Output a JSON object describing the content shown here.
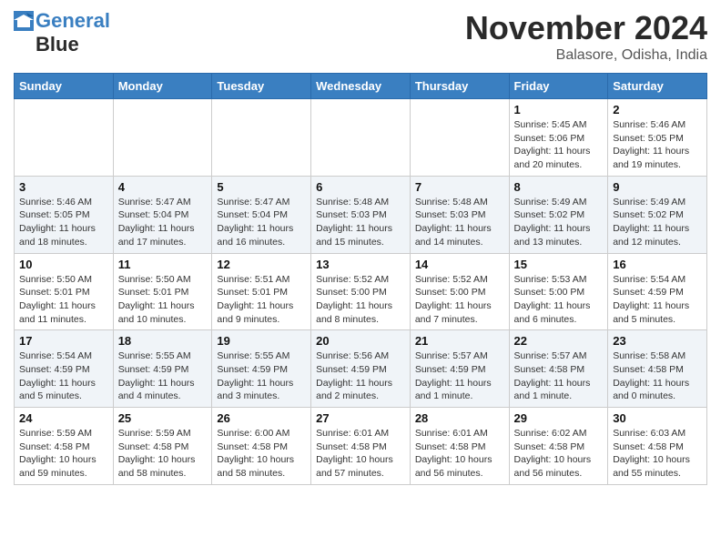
{
  "header": {
    "logo_line1": "General",
    "logo_line2": "Blue",
    "month_title": "November 2024",
    "location": "Balasore, Odisha, India"
  },
  "weekdays": [
    "Sunday",
    "Monday",
    "Tuesday",
    "Wednesday",
    "Thursday",
    "Friday",
    "Saturday"
  ],
  "weeks": [
    [
      {
        "day": "",
        "info": ""
      },
      {
        "day": "",
        "info": ""
      },
      {
        "day": "",
        "info": ""
      },
      {
        "day": "",
        "info": ""
      },
      {
        "day": "",
        "info": ""
      },
      {
        "day": "1",
        "info": "Sunrise: 5:45 AM\nSunset: 5:06 PM\nDaylight: 11 hours\nand 20 minutes."
      },
      {
        "day": "2",
        "info": "Sunrise: 5:46 AM\nSunset: 5:05 PM\nDaylight: 11 hours\nand 19 minutes."
      }
    ],
    [
      {
        "day": "3",
        "info": "Sunrise: 5:46 AM\nSunset: 5:05 PM\nDaylight: 11 hours\nand 18 minutes."
      },
      {
        "day": "4",
        "info": "Sunrise: 5:47 AM\nSunset: 5:04 PM\nDaylight: 11 hours\nand 17 minutes."
      },
      {
        "day": "5",
        "info": "Sunrise: 5:47 AM\nSunset: 5:04 PM\nDaylight: 11 hours\nand 16 minutes."
      },
      {
        "day": "6",
        "info": "Sunrise: 5:48 AM\nSunset: 5:03 PM\nDaylight: 11 hours\nand 15 minutes."
      },
      {
        "day": "7",
        "info": "Sunrise: 5:48 AM\nSunset: 5:03 PM\nDaylight: 11 hours\nand 14 minutes."
      },
      {
        "day": "8",
        "info": "Sunrise: 5:49 AM\nSunset: 5:02 PM\nDaylight: 11 hours\nand 13 minutes."
      },
      {
        "day": "9",
        "info": "Sunrise: 5:49 AM\nSunset: 5:02 PM\nDaylight: 11 hours\nand 12 minutes."
      }
    ],
    [
      {
        "day": "10",
        "info": "Sunrise: 5:50 AM\nSunset: 5:01 PM\nDaylight: 11 hours\nand 11 minutes."
      },
      {
        "day": "11",
        "info": "Sunrise: 5:50 AM\nSunset: 5:01 PM\nDaylight: 11 hours\nand 10 minutes."
      },
      {
        "day": "12",
        "info": "Sunrise: 5:51 AM\nSunset: 5:01 PM\nDaylight: 11 hours\nand 9 minutes."
      },
      {
        "day": "13",
        "info": "Sunrise: 5:52 AM\nSunset: 5:00 PM\nDaylight: 11 hours\nand 8 minutes."
      },
      {
        "day": "14",
        "info": "Sunrise: 5:52 AM\nSunset: 5:00 PM\nDaylight: 11 hours\nand 7 minutes."
      },
      {
        "day": "15",
        "info": "Sunrise: 5:53 AM\nSunset: 5:00 PM\nDaylight: 11 hours\nand 6 minutes."
      },
      {
        "day": "16",
        "info": "Sunrise: 5:54 AM\nSunset: 4:59 PM\nDaylight: 11 hours\nand 5 minutes."
      }
    ],
    [
      {
        "day": "17",
        "info": "Sunrise: 5:54 AM\nSunset: 4:59 PM\nDaylight: 11 hours\nand 5 minutes."
      },
      {
        "day": "18",
        "info": "Sunrise: 5:55 AM\nSunset: 4:59 PM\nDaylight: 11 hours\nand 4 minutes."
      },
      {
        "day": "19",
        "info": "Sunrise: 5:55 AM\nSunset: 4:59 PM\nDaylight: 11 hours\nand 3 minutes."
      },
      {
        "day": "20",
        "info": "Sunrise: 5:56 AM\nSunset: 4:59 PM\nDaylight: 11 hours\nand 2 minutes."
      },
      {
        "day": "21",
        "info": "Sunrise: 5:57 AM\nSunset: 4:59 PM\nDaylight: 11 hours\nand 1 minute."
      },
      {
        "day": "22",
        "info": "Sunrise: 5:57 AM\nSunset: 4:58 PM\nDaylight: 11 hours\nand 1 minute."
      },
      {
        "day": "23",
        "info": "Sunrise: 5:58 AM\nSunset: 4:58 PM\nDaylight: 11 hours\nand 0 minutes."
      }
    ],
    [
      {
        "day": "24",
        "info": "Sunrise: 5:59 AM\nSunset: 4:58 PM\nDaylight: 10 hours\nand 59 minutes."
      },
      {
        "day": "25",
        "info": "Sunrise: 5:59 AM\nSunset: 4:58 PM\nDaylight: 10 hours\nand 58 minutes."
      },
      {
        "day": "26",
        "info": "Sunrise: 6:00 AM\nSunset: 4:58 PM\nDaylight: 10 hours\nand 58 minutes."
      },
      {
        "day": "27",
        "info": "Sunrise: 6:01 AM\nSunset: 4:58 PM\nDaylight: 10 hours\nand 57 minutes."
      },
      {
        "day": "28",
        "info": "Sunrise: 6:01 AM\nSunset: 4:58 PM\nDaylight: 10 hours\nand 56 minutes."
      },
      {
        "day": "29",
        "info": "Sunrise: 6:02 AM\nSunset: 4:58 PM\nDaylight: 10 hours\nand 56 minutes."
      },
      {
        "day": "30",
        "info": "Sunrise: 6:03 AM\nSunset: 4:58 PM\nDaylight: 10 hours\nand 55 minutes."
      }
    ]
  ]
}
